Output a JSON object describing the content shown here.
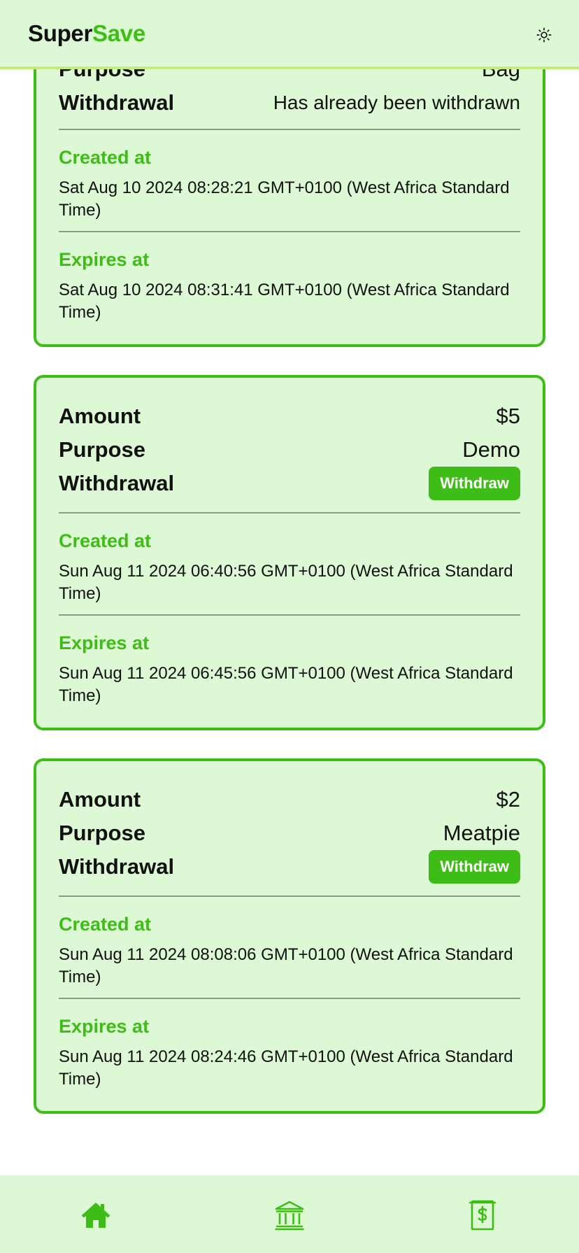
{
  "header": {
    "logo_part1": "Super",
    "logo_part2": "Save",
    "theme_icon": "sun-icon"
  },
  "colors": {
    "accent": "#3ebd16",
    "card_bg": "#ddf8d4",
    "header_border": "#c3ec78"
  },
  "cards": [
    {
      "purpose_label": "Purpose",
      "purpose_value": "Bag",
      "withdrawal_label": "Withdrawal",
      "withdrawal_status": "Has already been withdrawn",
      "created_label": "Created at",
      "created_value": "Sat Aug 10 2024 08:28:21 GMT+0100 (West Africa Standard Time)",
      "expires_label": "Expires at",
      "expires_value": "Sat Aug 10 2024 08:31:41 GMT+0100 (West Africa Standard Time)"
    },
    {
      "amount_label": "Amount",
      "amount_value": "$5",
      "purpose_label": "Purpose",
      "purpose_value": "Demo",
      "withdrawal_label": "Withdrawal",
      "withdraw_button": "Withdraw",
      "created_label": "Created at",
      "created_value": "Sun Aug 11 2024 06:40:56 GMT+0100 (West Africa Standard Time)",
      "expires_label": "Expires at",
      "expires_value": "Sun Aug 11 2024 06:45:56 GMT+0100 (West Africa Standard Time)"
    },
    {
      "amount_label": "Amount",
      "amount_value": "$2",
      "purpose_label": "Purpose",
      "purpose_value": "Meatpie",
      "withdrawal_label": "Withdrawal",
      "withdraw_button": "Withdraw",
      "created_label": "Created at",
      "created_value": "Sun Aug 11 2024 08:08:06 GMT+0100 (West Africa Standard Time)",
      "expires_label": "Expires at",
      "expires_value": "Sun Aug 11 2024 08:24:46 GMT+0100 (West Africa Standard Time)"
    }
  ],
  "bottom_nav": {
    "items": [
      "home-icon",
      "bank-icon",
      "savings-icon"
    ]
  }
}
